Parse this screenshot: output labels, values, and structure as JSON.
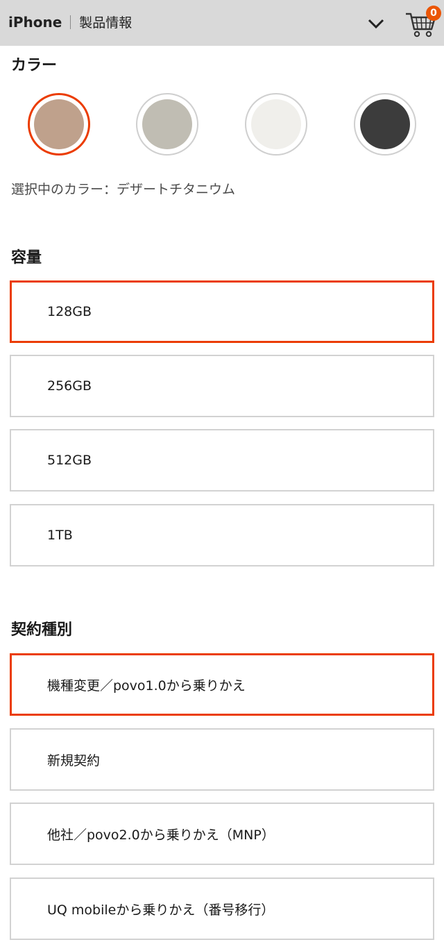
{
  "header": {
    "brand": "iPhone",
    "subtitle": "製品情報",
    "cart_count": "0"
  },
  "colors": {
    "accent": "#eb3c00",
    "badge": "#eb5505"
  },
  "color_section": {
    "title": "カラー",
    "swatches": [
      {
        "fill": "#bfa18c"
      },
      {
        "fill": "#c0bdb3"
      },
      {
        "fill": "#f0efeb"
      },
      {
        "fill": "#3c3c3c"
      }
    ],
    "selected_index": 0,
    "selected_text": "選択中のカラー：デザートチタニウム"
  },
  "capacity_section": {
    "title": "容量",
    "options": [
      "128GB",
      "256GB",
      "512GB",
      "1TB"
    ],
    "selected_index": 0
  },
  "contract_section": {
    "title": "契約種別",
    "options": [
      "機種変更／povo1.0から乗りかえ",
      "新規契約",
      "他社／povo2.0から乗りかえ（MNP）",
      "UQ mobileから乗りかえ（番号移行）"
    ],
    "selected_index": 0
  }
}
